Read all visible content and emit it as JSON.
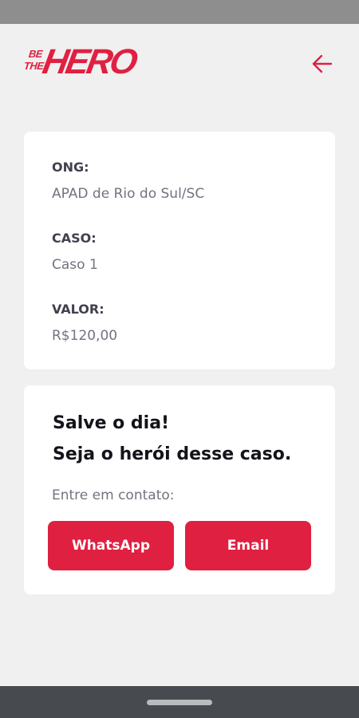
{
  "logo": {
    "line1": "BE",
    "line2": "THE",
    "word": "HERO"
  },
  "details": {
    "ong_label": "ONG:",
    "ong_value": "APAD de Rio do Sul/SC",
    "caso_label": "CASO:",
    "caso_value": "Caso 1",
    "valor_label": "VALOR:",
    "valor_value": "R$120,00"
  },
  "contact": {
    "title_line1": "Salve o dia!",
    "title_line2": "Seja o herói desse caso.",
    "description": "Entre em contato:",
    "whatsapp_label": "WhatsApp",
    "email_label": "Email"
  },
  "colors": {
    "accent": "#e02041",
    "background": "#f0f0f5",
    "card": "#ffffff"
  },
  "icons": {
    "back": "arrow-left-icon"
  }
}
